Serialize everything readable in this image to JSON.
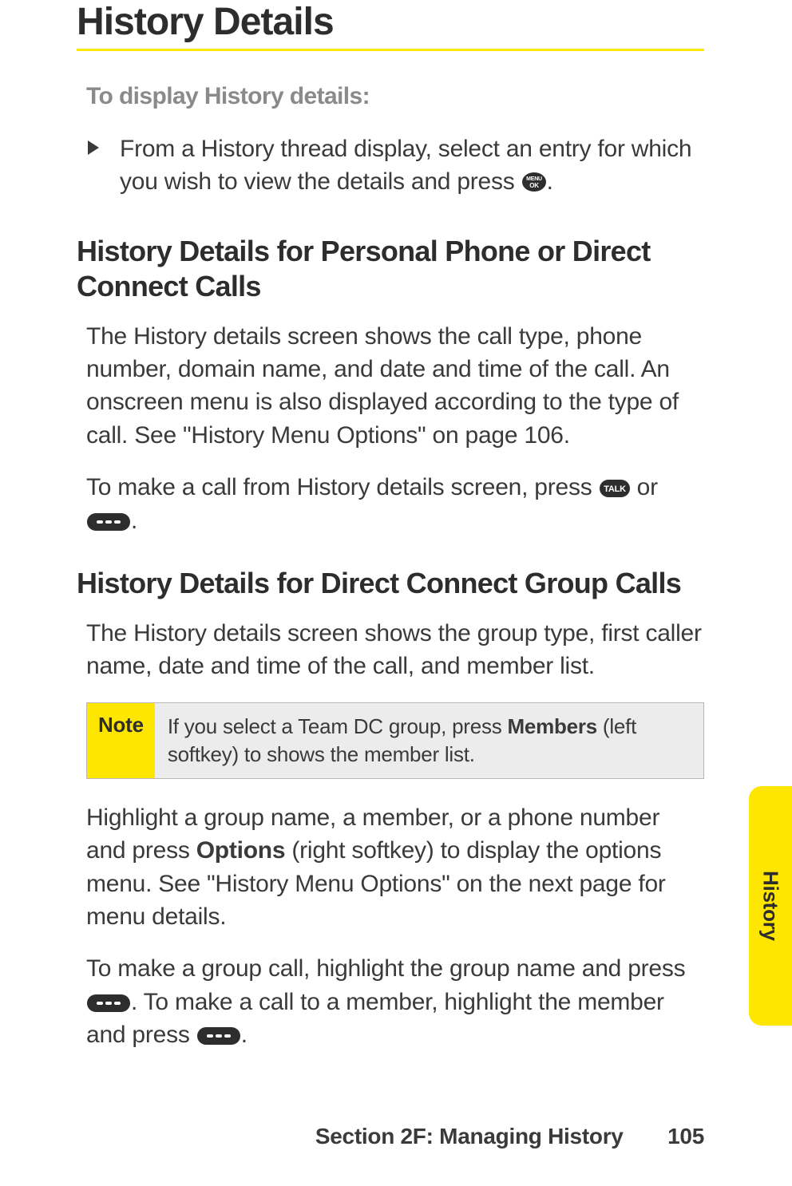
{
  "title": "History Details",
  "lead": "To display History details:",
  "step1_a": "From a History thread display, select an entry for which you wish to view the details and press ",
  "step1_b": ".",
  "sub1": "History Details for Personal Phone or Direct Connect Calls",
  "p1": "The History details screen shows the call type, phone number, domain name, and date and time of the call. An onscreen menu is also displayed according to the type of call. See \"History Menu Options\" on page 106.",
  "p2_a": "To make a call from History details screen, press ",
  "p2_or": " or ",
  "p2_b": ".",
  "sub2": "History Details for Direct Connect Group Calls",
  "p3": "The History details screen shows the group type, first caller name, date and time of the call, and member list.",
  "note_tag": "Note",
  "note_a": "If you select a Team DC group, press ",
  "note_bold": "Members",
  "note_b": " (left softkey) to shows the member list.",
  "p4_a": "Highlight a group name, a member, or a phone number and press ",
  "p4_bold": "Options",
  "p4_b": " (right softkey) to display the options menu. See \"History Menu Options\" on the next page for menu details.",
  "p5_a": "To make a group call, highlight the group name and press ",
  "p5_mid": ". To make a call to a member, highlight the member and press ",
  "p5_b": ".",
  "side_tab": "History",
  "footer_section": "Section 2F: Managing History",
  "footer_page": "105",
  "icons": {
    "menu_ok": "MENU/OK key",
    "talk": "TALK key",
    "dc": "Direct Connect key"
  }
}
